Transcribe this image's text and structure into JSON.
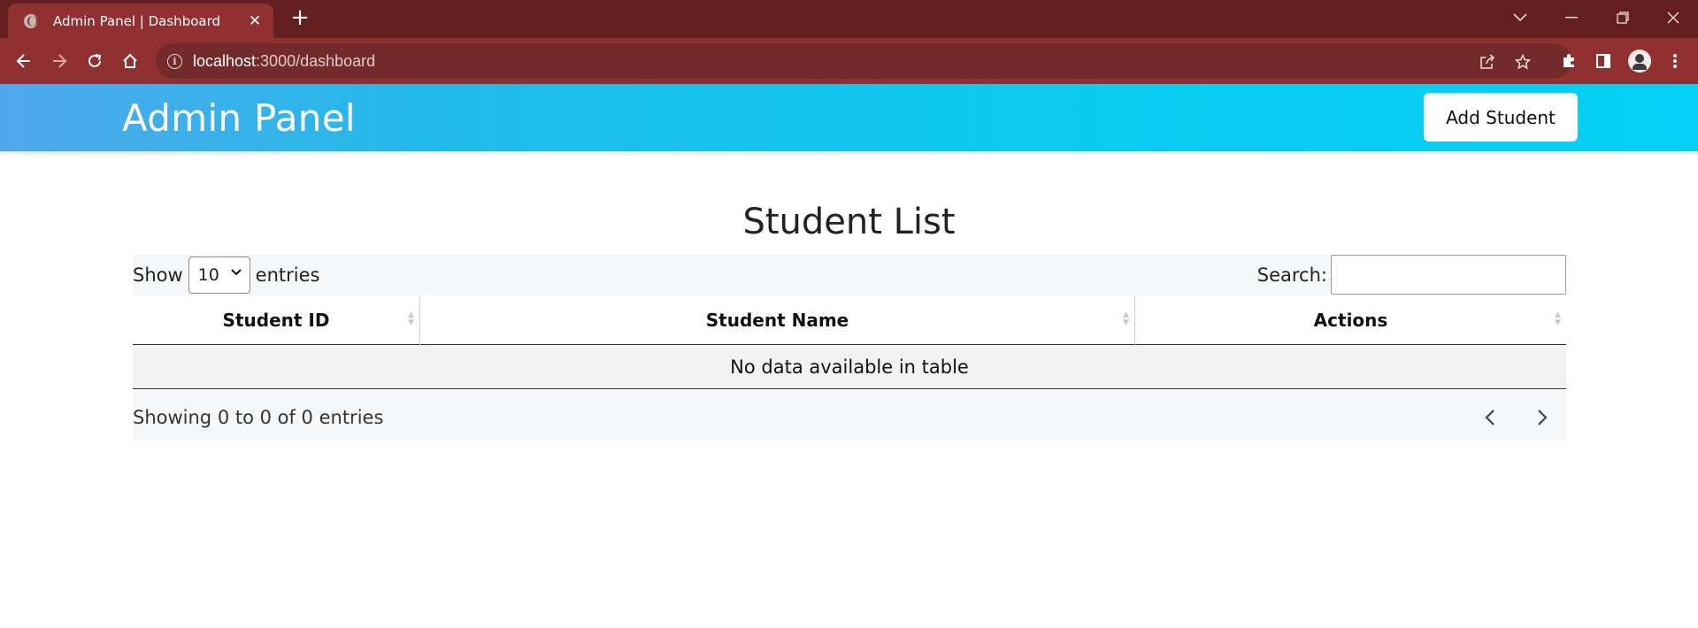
{
  "browser": {
    "tab_title": "Admin Panel | Dashboard",
    "tab_close": "✕",
    "new_tab": "+",
    "url_host": "localhost",
    "url_path": ":3000/dashboard",
    "window_controls": {
      "tab_search": "⌄",
      "minimize": "—",
      "restore": "❐",
      "close": "✕"
    },
    "icons": [
      "back-icon",
      "forward-icon",
      "reload-icon",
      "home-icon",
      "info-icon",
      "share-icon",
      "star-icon",
      "extensions-icon",
      "side-panel-icon",
      "profile-icon",
      "menu-icon"
    ]
  },
  "header": {
    "brand": "Admin Panel",
    "add_button": "Add Student",
    "gradient_start": "#51a8ea",
    "gradient_end": "#05d0f5"
  },
  "main": {
    "title": "Student List",
    "length_control": {
      "prefix": "Show",
      "selected": "10",
      "suffix": "entries"
    },
    "search_label": "Search:",
    "search_value": "",
    "table": {
      "columns": [
        "Student ID",
        "Student Name",
        "Actions"
      ],
      "rows": [],
      "empty_message": "No data available in table"
    },
    "info": "Showing 0 to 0 of 0 entries",
    "pager": {
      "previous": "‹",
      "next": "›"
    }
  }
}
